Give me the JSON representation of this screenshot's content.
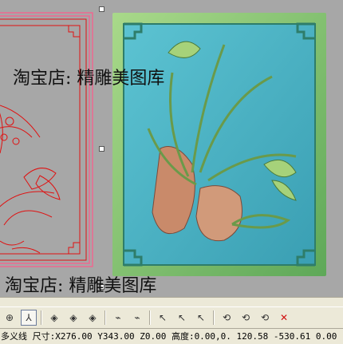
{
  "watermarks": {
    "top": "淘宝店: 精雕美图库",
    "bottom": "淘宝店: 精雕美图库"
  },
  "colors": {
    "viewport_bg": "#a7a7a7",
    "wire_pink": "#ff5a8a",
    "wire_red": "#e01010",
    "relief_frame": "#7fbf6a",
    "relief_panel": "#4fb8c8",
    "relief_flower": "#c98a6a"
  },
  "toolbar": {
    "buttons": [
      {
        "name": "view-mode-icon",
        "glyph": "⊕"
      },
      {
        "name": "select-node-icon",
        "glyph": "⅄"
      },
      {
        "name": "diamond-a-icon",
        "glyph": "◈"
      },
      {
        "name": "diamond-b-icon",
        "glyph": "◈"
      },
      {
        "name": "diamond-c-icon",
        "glyph": "◈"
      },
      {
        "name": "curve-draw-a-icon",
        "glyph": "⌁"
      },
      {
        "name": "curve-draw-b-icon",
        "glyph": "⌁"
      },
      {
        "name": "node-edit-a-icon",
        "glyph": "↖"
      },
      {
        "name": "node-edit-b-icon",
        "glyph": "↖"
      },
      {
        "name": "node-edit-c-icon",
        "glyph": "↖"
      },
      {
        "name": "transform-a-icon",
        "glyph": "⟲"
      },
      {
        "name": "transform-b-icon",
        "glyph": "⟲"
      },
      {
        "name": "transform-c-icon",
        "glyph": "⟲"
      },
      {
        "name": "delete-icon",
        "glyph": "✕"
      }
    ]
  },
  "status": {
    "text": "多义线 尺寸:X276.00 Y343.00 Z0.00 高度:0.00,0. 120.58 -530.61 0.00"
  }
}
